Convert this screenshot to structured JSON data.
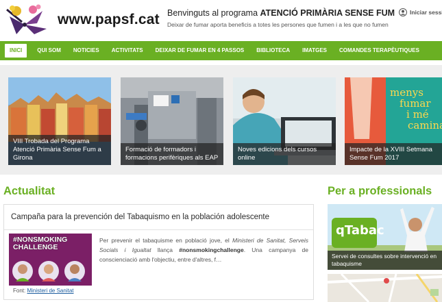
{
  "header": {
    "site_name": "www.papsf.cat",
    "welcome_prefix": "Benvinguts al programa",
    "welcome_program": "ATENCIÓ PRIMÀRIA SENSE FUM",
    "tagline": "Deixar de fumar aporta beneficis a totes les persones que fumen i a les que no fumen",
    "login_label": "Iniciar sessió"
  },
  "nav": {
    "items": [
      "INICI",
      "QUI SOM",
      "NOTICIES",
      "ACTIVITATS",
      "DEIXAR DE FUMAR EN 4 PASSOS",
      "BIBLIOTECA",
      "IMATGES",
      "COMANDES TERAPÈUTIQUES"
    ],
    "active_index": 0
  },
  "slides": [
    {
      "caption": "VIII Trobada del Programa Atenció Primària Sense Fum a Girona"
    },
    {
      "caption": "Formació de formadors i formacions perifèriques als EAP"
    },
    {
      "caption": "Noves edicions dels cursos online"
    },
    {
      "caption": "Impacte de la XVIII Setmana Sense Fum 2017",
      "poster_text": [
        "menys",
        "fumar",
        "i mé",
        "camina"
      ]
    }
  ],
  "actualitat": {
    "title": "Actualitat",
    "news": {
      "title": "Campaña para la prevención del Tabaquismo en la población adolescente",
      "thumb_text": "#NONSMOKING CHALLENGE",
      "body_1": "Per prevenir el tabaquisme en població jove, el ",
      "body_ministry": "Ministeri de Sanitat, Serveis Socials i Igualtat",
      "body_2": " llança ",
      "body_hashtag": "#nonsmokingchallenge",
      "body_3": ". Una campanya de conscienciació amb l'objectiu, entre d'altres, f…",
      "source_label": "Font:",
      "source_link": "Ministeri de Sanitat"
    }
  },
  "professionals": {
    "title": "Per a professionals",
    "card_caption": "Servei de consultes sobre intervenció en tabaquisme",
    "card_logo": "qTabac"
  },
  "colors": {
    "brand_green": "#6ab023",
    "caption_overlay": "#232323",
    "challenge_purple": "#7b1f66",
    "link_blue": "#1f5fa0"
  }
}
